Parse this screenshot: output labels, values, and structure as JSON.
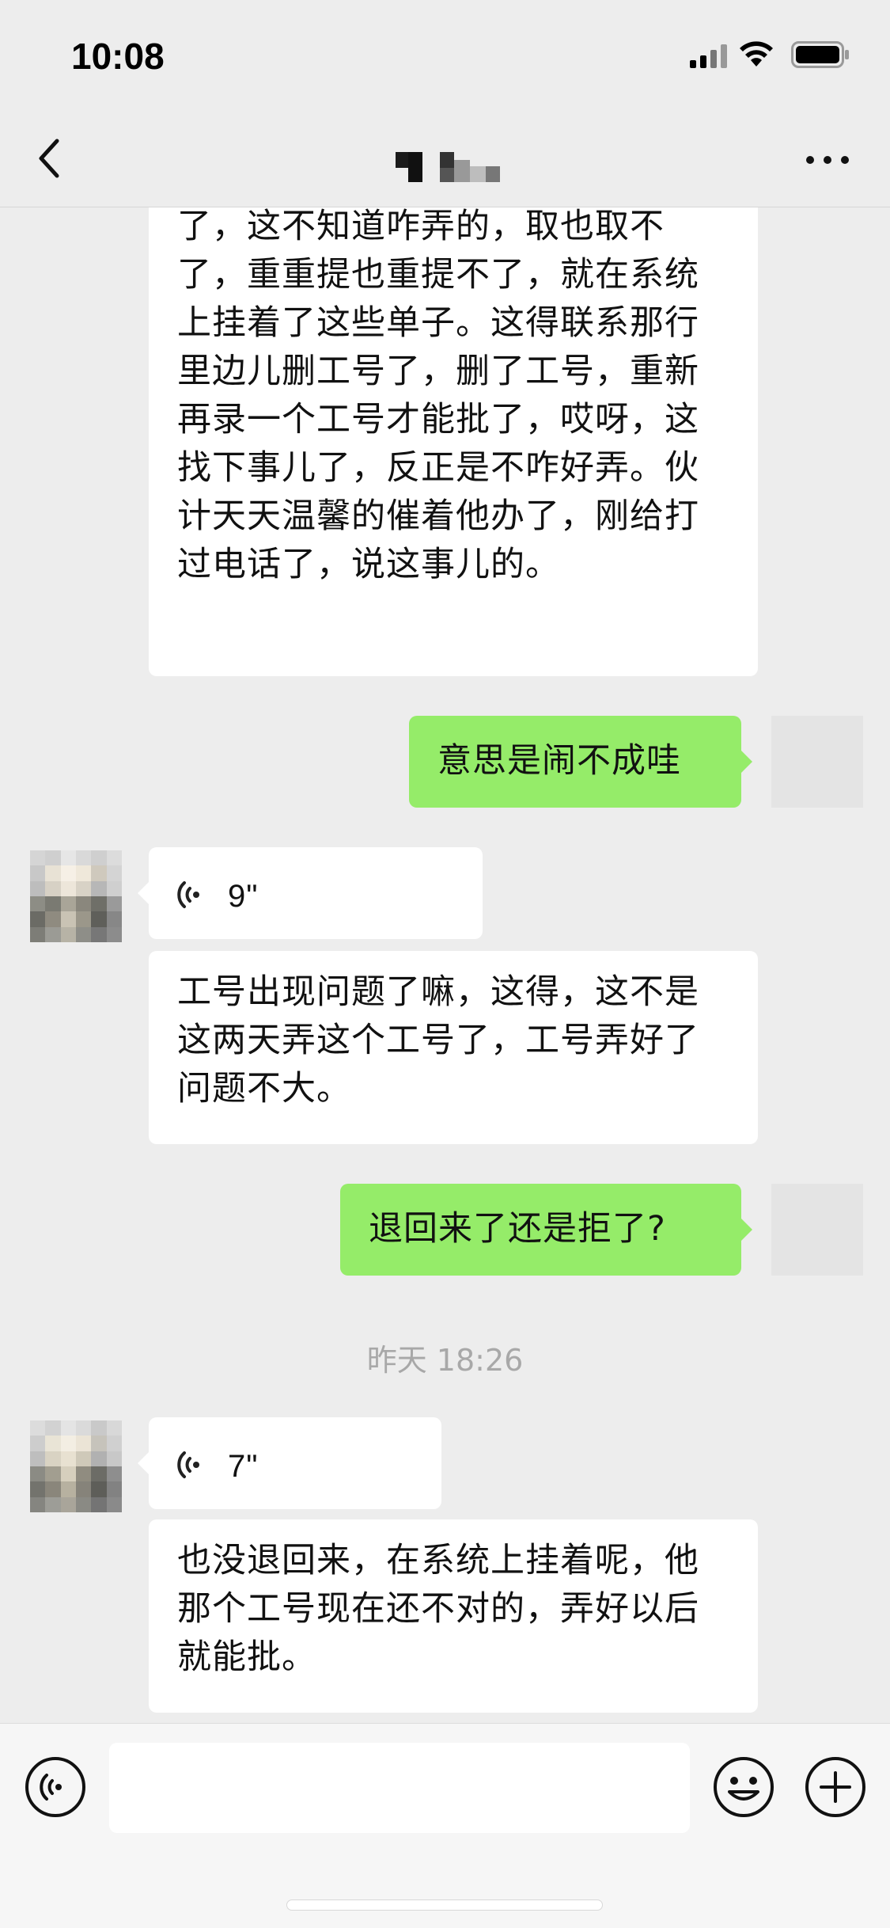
{
  "status_bar": {
    "time": "10:08"
  },
  "nav": {
    "back": "back",
    "more": "more"
  },
  "messages": [
    {
      "id": "m1",
      "side": "in",
      "type": "text",
      "text": "了，这不知道咋弄的，取也取不了，重重提也重提不了，就在系统上挂着了这些单子。这得联系那行里边儿删工号了，删了工号，重新再录一个工号才能批了，哎呀，这找下事儿了，反正是不咋好弄。伙计天天温馨的催着他办了，刚给打过电话了，说这事儿的。"
    },
    {
      "id": "m2",
      "side": "out",
      "type": "text",
      "text": "意思是闹不成哇"
    },
    {
      "id": "m3",
      "side": "in",
      "type": "voice",
      "duration": "9\""
    },
    {
      "id": "m4",
      "side": "in",
      "type": "text",
      "text": "工号出现问题了嘛，这得，这不是这两天弄这个工号了，工号弄好了问题不大。"
    },
    {
      "id": "m5",
      "side": "out",
      "type": "text",
      "text": "退回来了还是拒了?"
    },
    {
      "id": "m6",
      "side": "in",
      "type": "voice",
      "duration": "7\""
    },
    {
      "id": "m7",
      "side": "in",
      "type": "text",
      "text": "也没退回来，在系统上挂着呢，他那个工号现在还不对的，弄好以后就能批。"
    }
  ],
  "timestamp": "昨天 18:26",
  "colors": {
    "incoming": "#ffffff",
    "outgoing": "#95ec69",
    "background": "#ededed"
  },
  "input_bar": {
    "text_value": "",
    "icons": [
      "voice-icon",
      "emoji-icon",
      "plus-icon"
    ]
  }
}
